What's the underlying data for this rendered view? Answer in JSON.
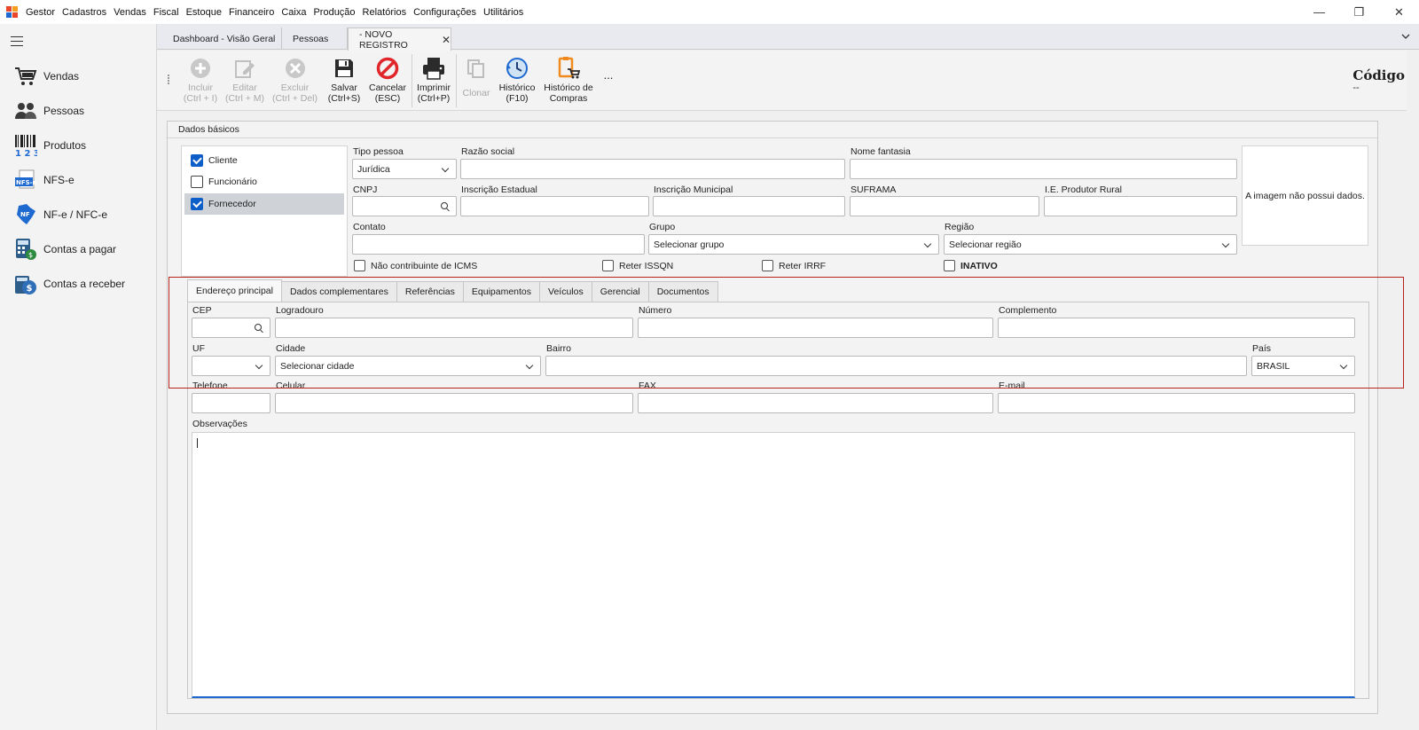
{
  "app": {
    "title": "Gestor",
    "menu": [
      "Cadastros",
      "Vendas",
      "Fiscal",
      "Estoque",
      "Financeiro",
      "Caixa",
      "Produção",
      "Relatórios",
      "Configurações",
      "Utilitários"
    ]
  },
  "window_controls": {
    "minimize": "—",
    "restore": "❐",
    "close": "✕"
  },
  "sidebar": {
    "items": [
      {
        "label": "Vendas",
        "icon": "cart-icon"
      },
      {
        "label": "Pessoas",
        "icon": "people-icon"
      },
      {
        "label": "Produtos",
        "icon": "barcode-icon"
      },
      {
        "label": "NFS-e",
        "icon": "nfse-icon"
      },
      {
        "label": "NF-e / NFC-e",
        "icon": "nfe-icon"
      },
      {
        "label": "Contas a pagar",
        "icon": "calculator-icon"
      },
      {
        "label": "Contas a receber",
        "icon": "money-icon"
      }
    ]
  },
  "tabs": [
    {
      "label": "Dashboard - Visão Geral"
    },
    {
      "label": "Pessoas"
    },
    {
      "label": "- NOVO REGISTRO",
      "close": "✕"
    }
  ],
  "toolbar": {
    "incluir": [
      "Incluir",
      "(Ctrl + I)"
    ],
    "editar": [
      "Editar",
      "(Ctrl + M)"
    ],
    "excluir": [
      "Excluir",
      "(Ctrl + Del)"
    ],
    "salvar": [
      "Salvar",
      "(Ctrl+S)"
    ],
    "cancelar": [
      "Cancelar",
      "(ESC)"
    ],
    "imprimir": [
      "Imprimir",
      "(Ctrl+P)"
    ],
    "clonar": "Clonar",
    "historico": [
      "Histórico",
      "(F10)"
    ],
    "historico_compras": [
      "Histórico de",
      "Compras"
    ],
    "more": "..."
  },
  "codigo": {
    "label": "Código",
    "value": "--"
  },
  "dados_basicos": {
    "title": "Dados básicos",
    "types": [
      {
        "label": "Cliente",
        "checked": true
      },
      {
        "label": "Funcionário",
        "checked": false
      },
      {
        "label": "Fornecedor",
        "checked": true
      }
    ],
    "fields": {
      "tipo_pessoa": {
        "label": "Tipo pessoa",
        "value": "Jurídica"
      },
      "razao_social": {
        "label": "Razão social",
        "value": ""
      },
      "nome_fantasia": {
        "label": "Nome fantasia",
        "value": ""
      },
      "cnpj": {
        "label": "CNPJ",
        "value": ""
      },
      "inscricao_estadual": {
        "label": "Inscrição Estadual",
        "value": ""
      },
      "inscricao_municipal": {
        "label": "Inscrição Municipal",
        "value": ""
      },
      "suframa": {
        "label": "SUFRAMA",
        "value": ""
      },
      "ie_produtor": {
        "label": "I.E. Produtor Rural",
        "value": ""
      },
      "contato": {
        "label": "Contato",
        "value": ""
      },
      "grupo": {
        "label": "Grupo",
        "value": "Selecionar grupo"
      },
      "regiao": {
        "label": "Região",
        "value": "Selecionar região"
      }
    },
    "checks": {
      "nao_contribuinte": "Não contribuinte de ICMS",
      "reter_issqn": "Reter ISSQN",
      "reter_irrf": "Reter IRRF",
      "inativo": "INATIVO"
    },
    "image_placeholder": "A imagem não possui dados."
  },
  "inner_tabs": [
    "Endereço principal",
    "Dados complementares",
    "Referências",
    "Equipamentos",
    "Veículos",
    "Gerencial",
    "Documentos"
  ],
  "endereco": {
    "cep": {
      "label": "CEP",
      "value": ""
    },
    "logradouro": {
      "label": "Logradouro",
      "value": ""
    },
    "numero": {
      "label": "Número",
      "value": ""
    },
    "complemento": {
      "label": "Complemento",
      "value": ""
    },
    "uf": {
      "label": "UF",
      "value": ""
    },
    "cidade": {
      "label": "Cidade",
      "value": "Selecionar cidade"
    },
    "bairro": {
      "label": "Bairro",
      "value": ""
    },
    "pais": {
      "label": "País",
      "value": "BRASIL"
    },
    "telefone": {
      "label": "Telefone",
      "value": ""
    },
    "celular": {
      "label": "Celular",
      "value": ""
    },
    "fax": {
      "label": "FAX",
      "value": ""
    },
    "email": {
      "label": "E-mail",
      "value": ""
    },
    "observacoes": {
      "label": "Observações",
      "value": ""
    }
  },
  "colors": {
    "accent": "#0e5ec9",
    "highlight": "#b7221c",
    "cancel_red": "#e0262a"
  }
}
